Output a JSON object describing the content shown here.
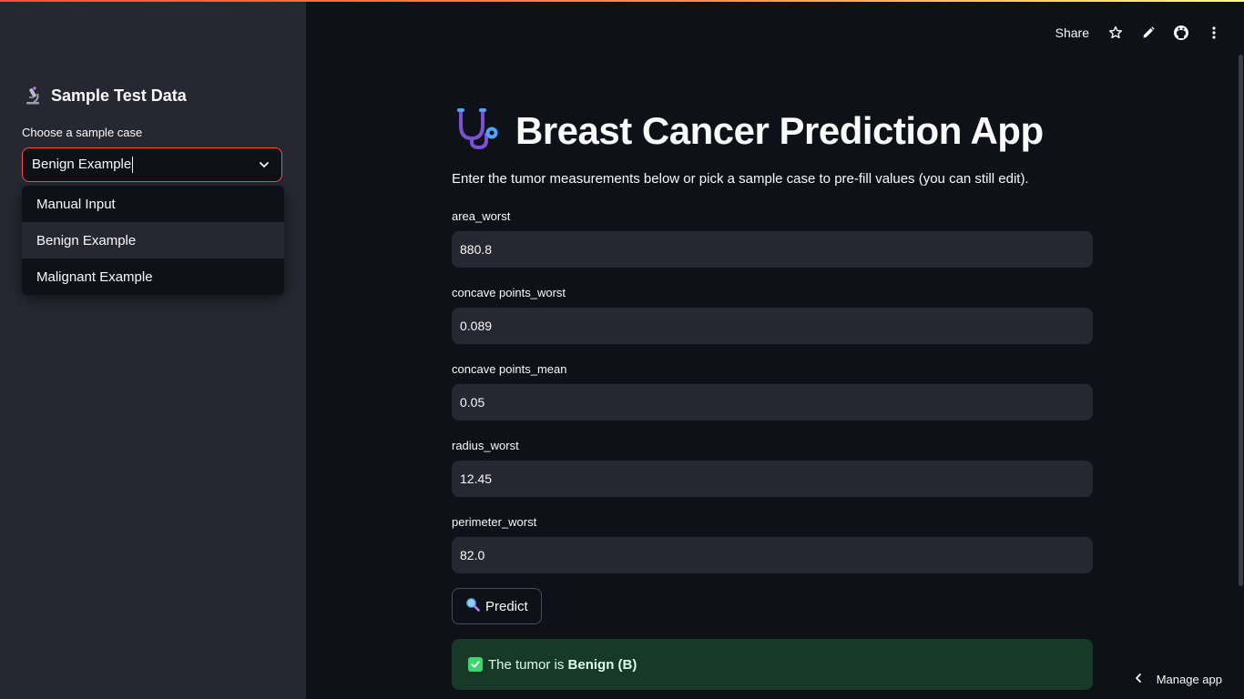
{
  "sidebar": {
    "title": "Sample Test Data",
    "title_icon": "microscope-icon",
    "select_label": "Choose a sample case",
    "select_value": "Benign Example",
    "options": [
      "Manual Input",
      "Benign Example",
      "Malignant Example"
    ],
    "active_option": "Benign Example"
  },
  "toolbar": {
    "share_label": "Share",
    "icons": [
      "star-icon",
      "pencil-icon",
      "github-icon",
      "more-vertical-icon"
    ]
  },
  "main": {
    "title": "Breast Cancer Prediction App",
    "title_icon": "stethoscope-icon",
    "subtitle": "Enter the tumor measurements below or pick a sample case to pre-fill values (you can still edit).",
    "fields": [
      {
        "label": "area_worst",
        "value": "880.8"
      },
      {
        "label": "concave points_worst",
        "value": "0.089"
      },
      {
        "label": "concave points_mean",
        "value": "0.05"
      },
      {
        "label": "radius_worst",
        "value": "12.45"
      },
      {
        "label": "perimeter_worst",
        "value": "82.0"
      }
    ],
    "predict_label": "Predict",
    "predict_icon": "magnifying-glass-icon",
    "result_prefix": "The tumor is ",
    "result_value": "Benign (B)",
    "result_icon": "check-box-icon"
  },
  "footer": {
    "manage_label": "Manage app"
  },
  "colors": {
    "accent": "#ff4b4b",
    "background": "#0e1117",
    "sidebar": "#262730",
    "success_bg": "#173928",
    "success_icon": "#3dd56d"
  }
}
